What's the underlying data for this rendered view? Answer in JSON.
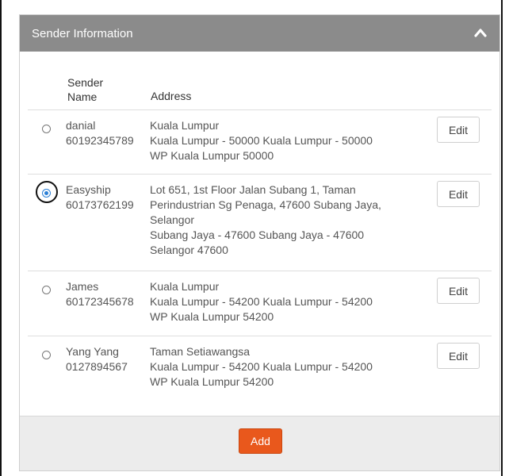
{
  "panel": {
    "title": "Sender Information",
    "collapse_icon": "chevron-up-icon"
  },
  "table": {
    "headers": {
      "name_line1": "Sender",
      "name_line2": "Name",
      "address": "Address"
    },
    "selected_index": 1,
    "rows": [
      {
        "name": "danial",
        "phone": "60192345789",
        "address_lines": [
          "Kuala Lumpur",
          "Kuala Lumpur - 50000 Kuala Lumpur - 50000",
          "WP Kuala Lumpur 50000"
        ],
        "edit_label": "Edit"
      },
      {
        "name": "Easyship",
        "phone": "60173762199",
        "address_lines": [
          "Lot 651, 1st Floor Jalan Subang 1, Taman",
          "Perindustrian Sg Penaga, 47600 Subang Jaya,",
          "Selangor",
          "Subang Jaya - 47600 Subang Jaya - 47600",
          "Selangor 47600"
        ],
        "edit_label": "Edit"
      },
      {
        "name": "James",
        "phone": "60172345678",
        "address_lines": [
          "Kuala Lumpur",
          "Kuala Lumpur - 54200 Kuala Lumpur - 54200",
          "WP Kuala Lumpur 54200"
        ],
        "edit_label": "Edit"
      },
      {
        "name": "Yang Yang",
        "phone": "0127894567",
        "address_lines": [
          "Taman Setiawangsa",
          "Kuala Lumpur - 54200 Kuala Lumpur - 54200",
          "WP Kuala Lumpur 54200"
        ],
        "edit_label": "Edit"
      }
    ]
  },
  "footer": {
    "add_label": "Add"
  },
  "colors": {
    "header_bg": "#8b8b8b",
    "add_button": "#e9581c",
    "radio_selected": "#2a7fd6"
  }
}
